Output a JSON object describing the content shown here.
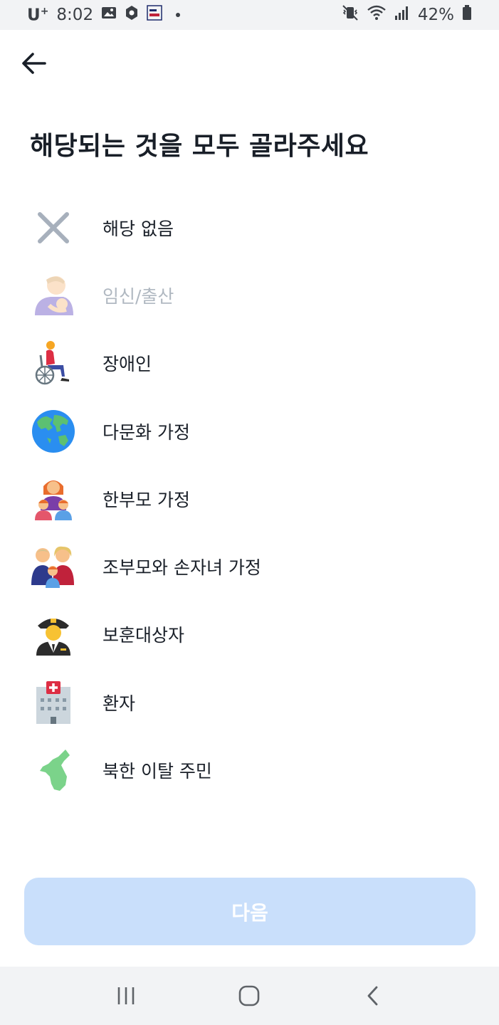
{
  "status_bar": {
    "carrier": "U",
    "carrier_sup": "+",
    "time": "8:02",
    "battery": "42%"
  },
  "title": "해당되는 것을 모두 골라주세요",
  "options": [
    {
      "label": "해당 없음",
      "icon": "close-x-icon",
      "disabled": false
    },
    {
      "label": "임신/출산",
      "icon": "breastfeeding-icon",
      "disabled": true
    },
    {
      "label": "장애인",
      "icon": "wheelchair-person-icon",
      "disabled": false
    },
    {
      "label": "다문화 가정",
      "icon": "globe-icon",
      "disabled": false
    },
    {
      "label": "한부모 가정",
      "icon": "single-parent-family-icon",
      "disabled": false
    },
    {
      "label": "조부모와 손자녀 가정",
      "icon": "grandparents-family-icon",
      "disabled": false
    },
    {
      "label": "보훈대상자",
      "icon": "pilot-icon",
      "disabled": false
    },
    {
      "label": "환자",
      "icon": "hospital-icon",
      "disabled": false
    },
    {
      "label": "북한 이탈 주민",
      "icon": "korea-map-icon",
      "disabled": false
    }
  ],
  "next_button": {
    "label": "다음"
  },
  "colors": {
    "accent_disabled": "#c9dffb",
    "title": "#191f28",
    "disabled_text": "#b0b8c1"
  }
}
